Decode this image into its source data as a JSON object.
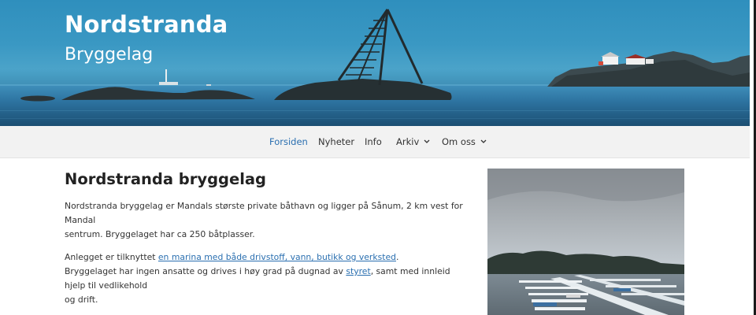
{
  "header": {
    "site_title": "Nordstranda",
    "site_subtitle": "Bryggelag"
  },
  "nav": {
    "items": [
      {
        "label": "Forsiden",
        "active": true
      },
      {
        "label": "Nyheter"
      },
      {
        "label": "Info"
      },
      {
        "label": "Arkiv",
        "has_dropdown": true
      },
      {
        "label": "Om oss",
        "has_dropdown": true
      }
    ]
  },
  "main": {
    "title": "Nordstranda bryggelag",
    "paragraph1_line1": "Nordstranda bryggelag er Mandals største private båthavn og ligger på Sånum, 2 km vest for Mandal",
    "paragraph1_line2": "sentrum. Bryggelaget har ca 250 båtplasser.",
    "paragraph2_prefix": "Anlegget er tilknyttet ",
    "paragraph2_link": "en marina med både drivstoff, vann, butikk og verksted",
    "paragraph2_suffix": ".",
    "paragraph3_prefix": "Bryggelaget har ingen ansatte og drives i høy grad på dugnad av ",
    "paragraph3_link": "styret",
    "paragraph3_suffix": ", samt med innleid hjelp til vedlikehold",
    "paragraph3_line2": "og drift."
  },
  "colors": {
    "link": "#2a6fb0",
    "nav_active": "#2a6fb0",
    "nav_background": "#f2f2f2",
    "hero_sky": "#3a98c3"
  }
}
